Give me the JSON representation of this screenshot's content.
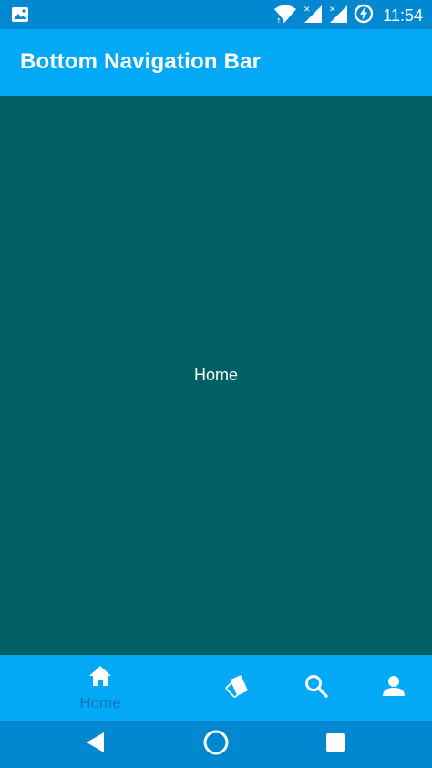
{
  "status_bar": {
    "time": "11:54",
    "icons": [
      "image-notification-icon",
      "wifi-icon",
      "signal-icon",
      "signal-icon",
      "battery-charging-icon"
    ]
  },
  "app_bar": {
    "title": "Bottom Navigation Bar"
  },
  "content": {
    "label": "Home",
    "background": "#006064"
  },
  "bottom_nav": {
    "items": [
      {
        "icon": "home-icon",
        "label": "Home",
        "selected": true
      },
      {
        "icon": "cards-icon",
        "label": "",
        "selected": false
      },
      {
        "icon": "search-icon",
        "label": "",
        "selected": false
      },
      {
        "icon": "person-icon",
        "label": "",
        "selected": false
      }
    ],
    "background": "#03A9F4",
    "selected_label_color": "#0277BD"
  },
  "system_nav": {
    "buttons": [
      "back-icon",
      "home-circle-icon",
      "recents-icon"
    ]
  },
  "colors": {
    "status_bar": "#0288D1",
    "app_bar": "#03A9F4"
  }
}
